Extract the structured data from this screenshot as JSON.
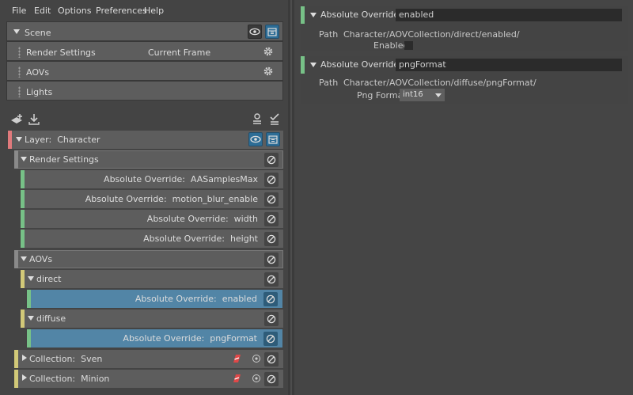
{
  "menu": [
    "File",
    "Edit",
    "Options",
    "Preferences",
    "Help"
  ],
  "scene": {
    "title": "Scene",
    "rows": [
      {
        "label": "Render Settings",
        "value": "Current Frame"
      },
      {
        "label": "AOVs"
      },
      {
        "label": "Lights"
      }
    ]
  },
  "tree": {
    "layer": {
      "prefix": "Layer:",
      "name": "Character"
    },
    "render_settings": "Render Settings",
    "rs_overrides": [
      {
        "prefix": "Absolute Override:",
        "name": "AASamplesMax"
      },
      {
        "prefix": "Absolute Override:",
        "name": "motion_blur_enable"
      },
      {
        "prefix": "Absolute Override:",
        "name": "width"
      },
      {
        "prefix": "Absolute Override:",
        "name": "height"
      }
    ],
    "aovs": "AOVs",
    "direct": "direct",
    "direct_override": {
      "prefix": "Absolute Override:",
      "name": "enabled"
    },
    "diffuse": "diffuse",
    "diffuse_override": {
      "prefix": "Absolute Override:",
      "name": "pngFormat"
    },
    "collections": [
      {
        "prefix": "Collection:",
        "name": "Sven"
      },
      {
        "prefix": "Collection:",
        "name": "Minion"
      }
    ]
  },
  "properties": [
    {
      "title": "Absolute Override:",
      "value": "enabled",
      "path_label": "Path",
      "path": "Character/AOVCollection/direct/enabled/",
      "attr_label": "Enabled",
      "attr_type": "checkbox"
    },
    {
      "title": "Absolute Override:",
      "value": "pngFormat",
      "path_label": "Path",
      "path": "Character/AOVCollection/diffuse/pngFormat/",
      "attr_label": "Png Format",
      "attr_type": "combo",
      "attr_value": "int16"
    }
  ],
  "colors": {
    "layer_bar": "#e07a7c",
    "override_bar": "#77c187",
    "collection_bar": "#d2c978",
    "group_bar": "#8a8a8a",
    "selected_row": "#5285a6",
    "accent_blue": "#2d6d96"
  }
}
